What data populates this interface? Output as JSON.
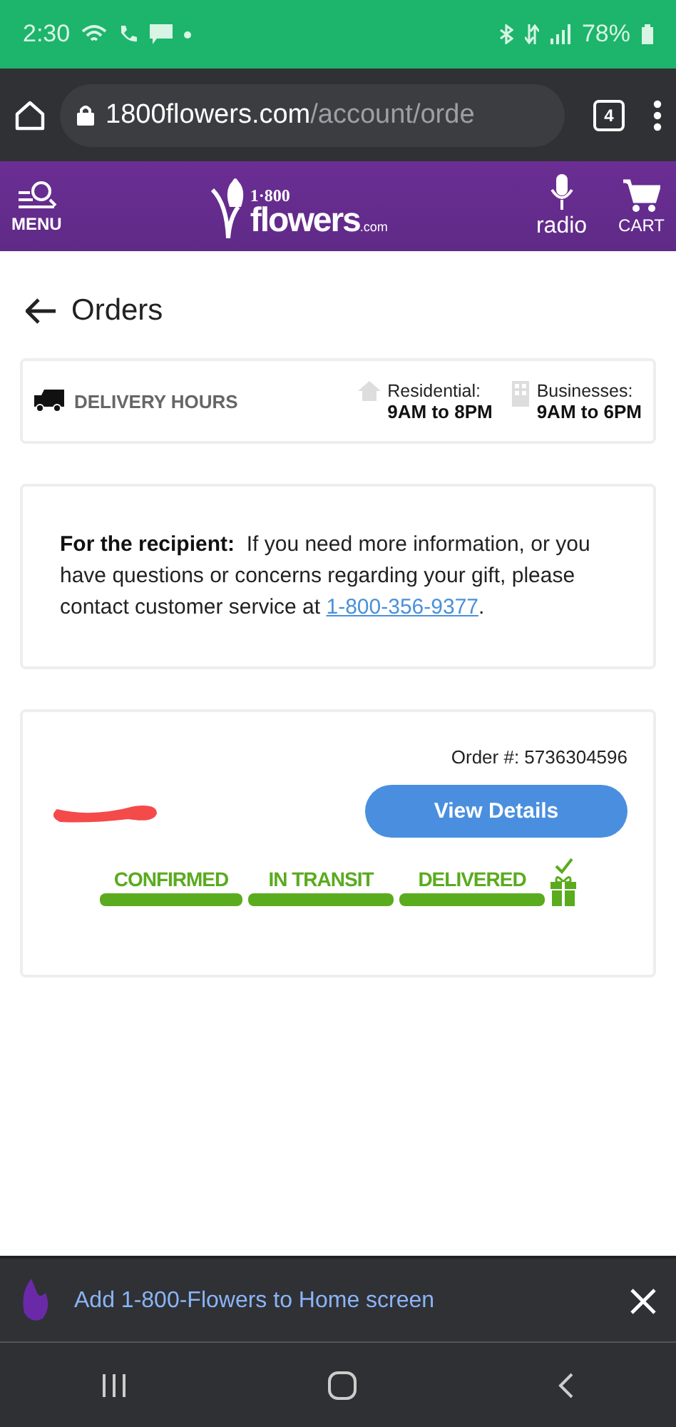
{
  "status_bar": {
    "time": "2:30",
    "battery": "78%"
  },
  "browser": {
    "url_host": "1800flowers.com",
    "url_path": "/account/orde",
    "tab_count": "4"
  },
  "header": {
    "menu_label": "MENU",
    "logo_number": "1·800",
    "logo_word": "flowers",
    "logo_suffix": ".com",
    "radio_label": "radio",
    "cart_label": "CART"
  },
  "page": {
    "title": "Orders"
  },
  "delivery_hours": {
    "label": "DELIVERY HOURS",
    "slots": [
      {
        "kind": "home",
        "name": "Residential:",
        "hours": "9AM to 8PM"
      },
      {
        "kind": "building",
        "name": "Businesses:",
        "hours": "9AM to 6PM"
      }
    ]
  },
  "recipient_note": {
    "lead": "For the recipient:",
    "text": "If you need more information, or you have questions or concerns regarding your gift, please contact customer service at",
    "phone": "1-800-356-9377",
    "end": "."
  },
  "order": {
    "number": "Order #: 5736304596",
    "button": "View Details",
    "steps": [
      {
        "label": "CONFIRMED",
        "completed": true
      },
      {
        "label": "IN TRANSIT",
        "completed": true
      },
      {
        "label": "DELIVERED",
        "completed": true
      }
    ]
  },
  "install_banner": {
    "text": "Add 1-800-Flowers to Home screen"
  }
}
